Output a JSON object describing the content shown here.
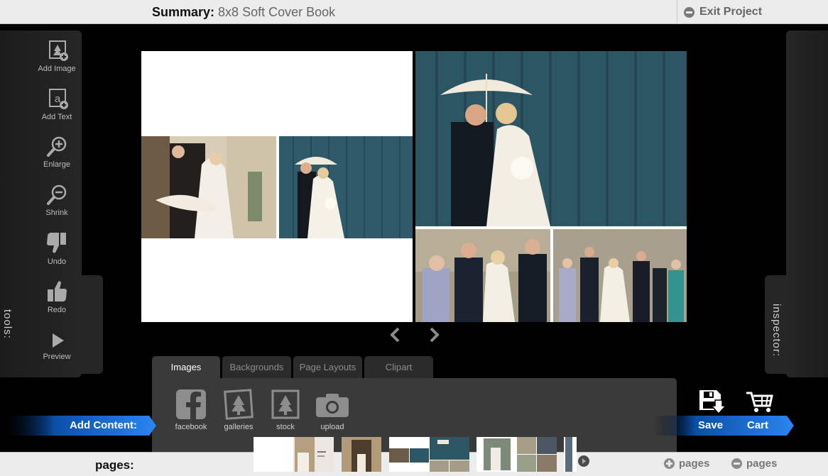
{
  "header": {
    "summary_label": "Summary:",
    "summary_value": "8x8 Soft Cover Book",
    "exit_label": "Exit Project"
  },
  "tools": {
    "tab_label": "tools:",
    "items": [
      {
        "label": "Add Image",
        "icon": "add-image-icon"
      },
      {
        "label": "Add Text",
        "icon": "add-text-icon"
      },
      {
        "label": "Enlarge",
        "icon": "zoom-in-icon"
      },
      {
        "label": "Shrink",
        "icon": "zoom-out-icon"
      },
      {
        "label": "Undo",
        "icon": "thumbs-down-icon"
      },
      {
        "label": "Redo",
        "icon": "thumbs-up-icon"
      },
      {
        "label": "Preview",
        "icon": "play-icon"
      }
    ]
  },
  "inspector": {
    "tab_label": "inspector:"
  },
  "content": {
    "tabs": [
      {
        "label": "Images",
        "active": true
      },
      {
        "label": "Backgrounds",
        "active": false
      },
      {
        "label": "Page Layouts",
        "active": false
      },
      {
        "label": "Clipart",
        "active": false
      }
    ],
    "sources": [
      {
        "label": "facebook",
        "icon": "facebook-icon"
      },
      {
        "label": "galleries",
        "icon": "galleries-icon"
      },
      {
        "label": "stock",
        "icon": "stock-icon"
      },
      {
        "label": "upload",
        "icon": "camera-icon"
      }
    ],
    "add_content_label": "Add Content:"
  },
  "actions": {
    "save_label": "Save",
    "cart_label": "Cart"
  },
  "footer": {
    "pages_label": "pages:",
    "add_pages_label": "pages",
    "remove_pages_label": "pages"
  },
  "colors": {
    "accent_blue": "#1f7be6",
    "panel_dark": "#262626",
    "bar_light": "#ececec"
  }
}
